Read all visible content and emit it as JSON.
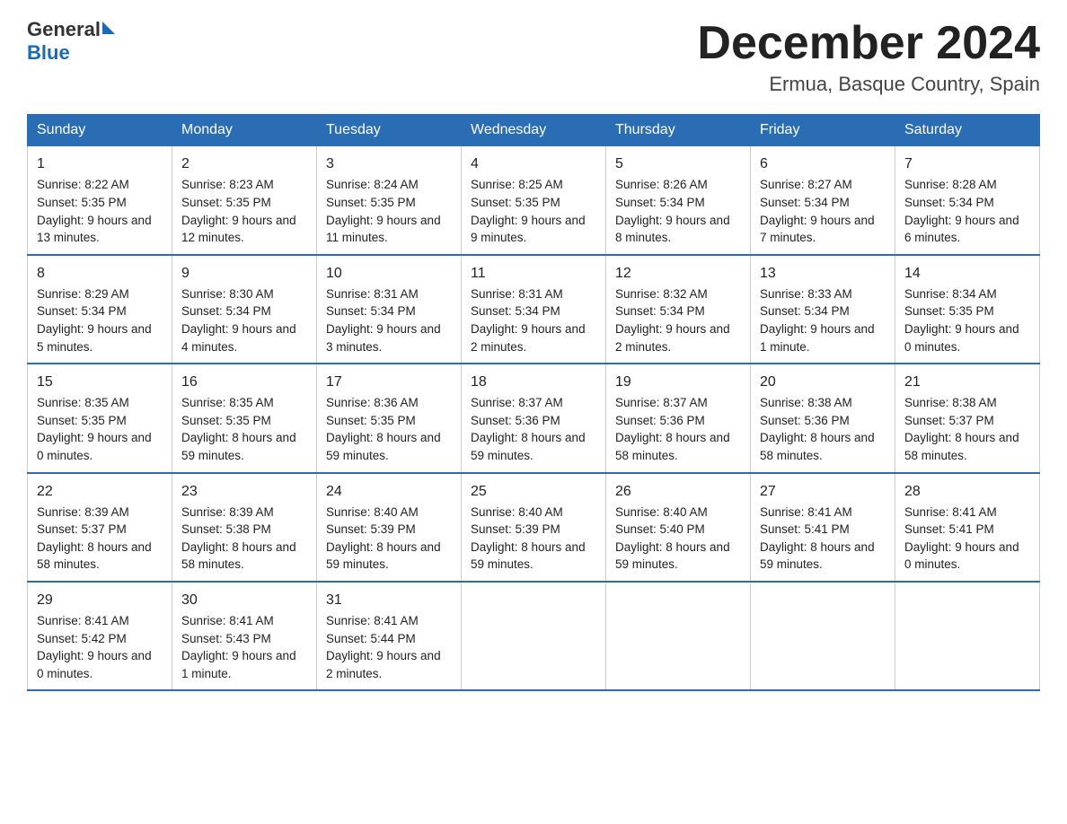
{
  "header": {
    "logo_general": "General",
    "logo_blue": "Blue",
    "month_title": "December 2024",
    "location": "Ermua, Basque Country, Spain"
  },
  "weekdays": [
    "Sunday",
    "Monday",
    "Tuesday",
    "Wednesday",
    "Thursday",
    "Friday",
    "Saturday"
  ],
  "weeks": [
    [
      {
        "day": "1",
        "sunrise": "8:22 AM",
        "sunset": "5:35 PM",
        "daylight": "9 hours and 13 minutes."
      },
      {
        "day": "2",
        "sunrise": "8:23 AM",
        "sunset": "5:35 PM",
        "daylight": "9 hours and 12 minutes."
      },
      {
        "day": "3",
        "sunrise": "8:24 AM",
        "sunset": "5:35 PM",
        "daylight": "9 hours and 11 minutes."
      },
      {
        "day": "4",
        "sunrise": "8:25 AM",
        "sunset": "5:35 PM",
        "daylight": "9 hours and 9 minutes."
      },
      {
        "day": "5",
        "sunrise": "8:26 AM",
        "sunset": "5:34 PM",
        "daylight": "9 hours and 8 minutes."
      },
      {
        "day": "6",
        "sunrise": "8:27 AM",
        "sunset": "5:34 PM",
        "daylight": "9 hours and 7 minutes."
      },
      {
        "day": "7",
        "sunrise": "8:28 AM",
        "sunset": "5:34 PM",
        "daylight": "9 hours and 6 minutes."
      }
    ],
    [
      {
        "day": "8",
        "sunrise": "8:29 AM",
        "sunset": "5:34 PM",
        "daylight": "9 hours and 5 minutes."
      },
      {
        "day": "9",
        "sunrise": "8:30 AM",
        "sunset": "5:34 PM",
        "daylight": "9 hours and 4 minutes."
      },
      {
        "day": "10",
        "sunrise": "8:31 AM",
        "sunset": "5:34 PM",
        "daylight": "9 hours and 3 minutes."
      },
      {
        "day": "11",
        "sunrise": "8:31 AM",
        "sunset": "5:34 PM",
        "daylight": "9 hours and 2 minutes."
      },
      {
        "day": "12",
        "sunrise": "8:32 AM",
        "sunset": "5:34 PM",
        "daylight": "9 hours and 2 minutes."
      },
      {
        "day": "13",
        "sunrise": "8:33 AM",
        "sunset": "5:34 PM",
        "daylight": "9 hours and 1 minute."
      },
      {
        "day": "14",
        "sunrise": "8:34 AM",
        "sunset": "5:35 PM",
        "daylight": "9 hours and 0 minutes."
      }
    ],
    [
      {
        "day": "15",
        "sunrise": "8:35 AM",
        "sunset": "5:35 PM",
        "daylight": "9 hours and 0 minutes."
      },
      {
        "day": "16",
        "sunrise": "8:35 AM",
        "sunset": "5:35 PM",
        "daylight": "8 hours and 59 minutes."
      },
      {
        "day": "17",
        "sunrise": "8:36 AM",
        "sunset": "5:35 PM",
        "daylight": "8 hours and 59 minutes."
      },
      {
        "day": "18",
        "sunrise": "8:37 AM",
        "sunset": "5:36 PM",
        "daylight": "8 hours and 59 minutes."
      },
      {
        "day": "19",
        "sunrise": "8:37 AM",
        "sunset": "5:36 PM",
        "daylight": "8 hours and 58 minutes."
      },
      {
        "day": "20",
        "sunrise": "8:38 AM",
        "sunset": "5:36 PM",
        "daylight": "8 hours and 58 minutes."
      },
      {
        "day": "21",
        "sunrise": "8:38 AM",
        "sunset": "5:37 PM",
        "daylight": "8 hours and 58 minutes."
      }
    ],
    [
      {
        "day": "22",
        "sunrise": "8:39 AM",
        "sunset": "5:37 PM",
        "daylight": "8 hours and 58 minutes."
      },
      {
        "day": "23",
        "sunrise": "8:39 AM",
        "sunset": "5:38 PM",
        "daylight": "8 hours and 58 minutes."
      },
      {
        "day": "24",
        "sunrise": "8:40 AM",
        "sunset": "5:39 PM",
        "daylight": "8 hours and 59 minutes."
      },
      {
        "day": "25",
        "sunrise": "8:40 AM",
        "sunset": "5:39 PM",
        "daylight": "8 hours and 59 minutes."
      },
      {
        "day": "26",
        "sunrise": "8:40 AM",
        "sunset": "5:40 PM",
        "daylight": "8 hours and 59 minutes."
      },
      {
        "day": "27",
        "sunrise": "8:41 AM",
        "sunset": "5:41 PM",
        "daylight": "8 hours and 59 minutes."
      },
      {
        "day": "28",
        "sunrise": "8:41 AM",
        "sunset": "5:41 PM",
        "daylight": "9 hours and 0 minutes."
      }
    ],
    [
      {
        "day": "29",
        "sunrise": "8:41 AM",
        "sunset": "5:42 PM",
        "daylight": "9 hours and 0 minutes."
      },
      {
        "day": "30",
        "sunrise": "8:41 AM",
        "sunset": "5:43 PM",
        "daylight": "9 hours and 1 minute."
      },
      {
        "day": "31",
        "sunrise": "8:41 AM",
        "sunset": "5:44 PM",
        "daylight": "9 hours and 2 minutes."
      },
      null,
      null,
      null,
      null
    ]
  ],
  "labels": {
    "sunrise": "Sunrise:",
    "sunset": "Sunset:",
    "daylight": "Daylight:"
  }
}
